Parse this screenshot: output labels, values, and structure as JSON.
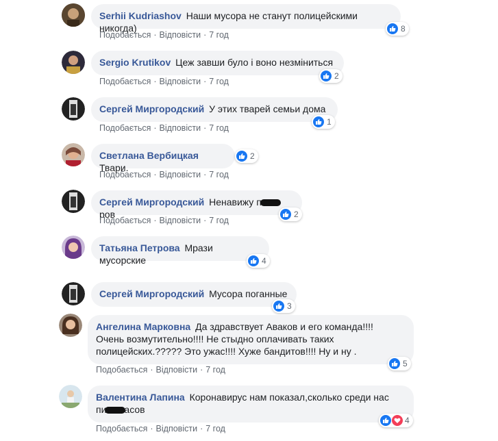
{
  "labels": {
    "like": "Подобається",
    "reply": "Відповісти"
  },
  "comments": [
    {
      "author": "Serhii Kudriashov",
      "text": "Наши мусора не станут полицейскими никогда)",
      "time": "7 год",
      "reactions": "8",
      "avatar_color": "#4a3a2a"
    },
    {
      "author": "Sergio Krutikov",
      "text": "Цеж завши було і воно незміниться",
      "time": "7 год",
      "reactions": "2",
      "avatar_color": "#2d2a3a"
    },
    {
      "author": "Сергей Миргородский",
      "text": "У этих тварей семьи дома",
      "time": "7 год",
      "reactions": "1",
      "avatar_color": "#1a1a1a"
    },
    {
      "author": "Светлана Вербицкая",
      "text": "Твари.",
      "time": "7 год",
      "reactions": "2",
      "avatar_color": "#8a5a4a"
    },
    {
      "author": "Сергей Миргородский",
      "text_a": "Ненавижу п",
      "text_b": "ров",
      "time": "7 год",
      "reactions": "2",
      "avatar_color": "#1a1a1a"
    },
    {
      "author": "Татьяна Петрова",
      "text": "Мрази мусорские",
      "time": "7 год",
      "reactions": "4",
      "avatar_color": "#5a3a6a"
    },
    {
      "author": "Сергей Миргородский",
      "text": "Мусора поганные",
      "time": "7 год",
      "reactions": "3",
      "avatar_color": "#1a1a1a"
    },
    {
      "author": "Ангелина Марковна",
      "line1": "Да здравствует Аваков и его команда!!!!",
      "line2": "Очень возмутительно!!!! Не стыдно оплачивать таких",
      "line3": "полицейских.????? Это ужас!!!! Хуже бандитов!!!! Ну и ну .",
      "time": "7 год",
      "reactions": "5",
      "avatar_color": "#6a5040"
    },
    {
      "author": "Валентина Лапина",
      "line1": "Коронавирус нам показал,сколько среди нас",
      "line2_a": "пи",
      "line2_b": "асов",
      "time": "7 год",
      "reactions": "4",
      "avatar_color": "#9ab0c0"
    }
  ]
}
